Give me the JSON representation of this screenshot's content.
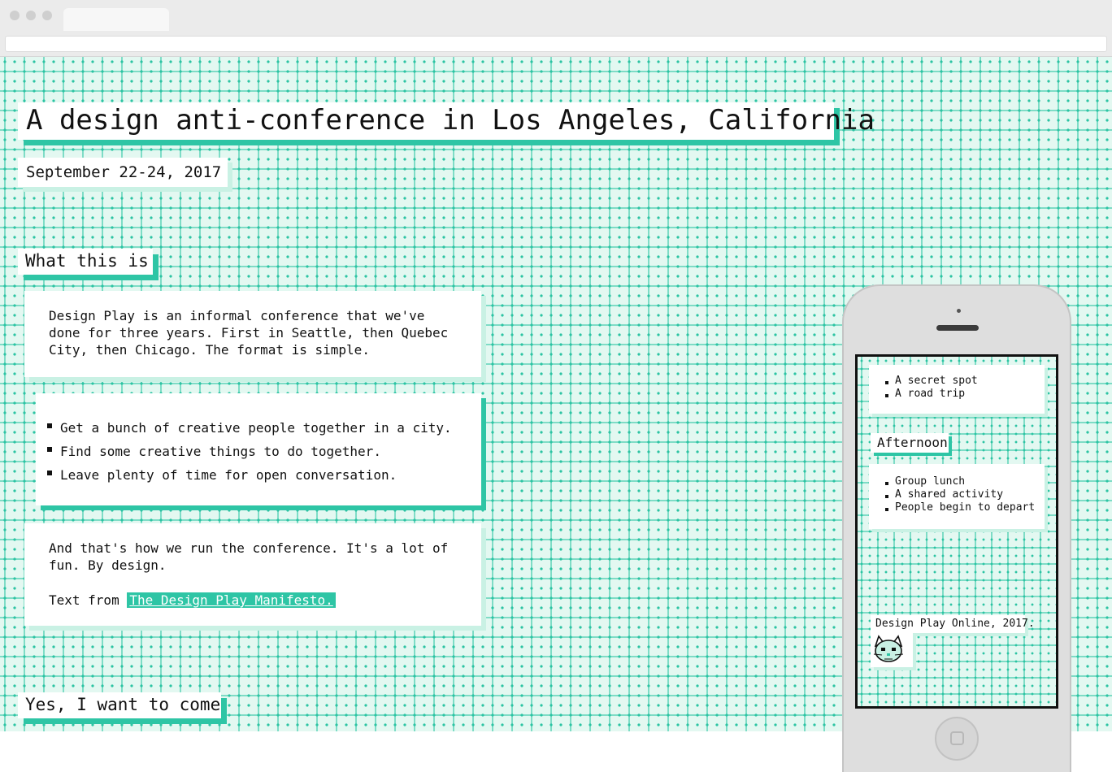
{
  "hero": {
    "title": "A design anti-conference in Los Angeles, California",
    "dates": "September 22-24, 2017"
  },
  "about": {
    "heading": "What this is",
    "intro": "Design Play is an informal conference that we've done for three years. First in Seattle, then Quebec City, then Chicago. The format is simple.",
    "steps": [
      "Get a bunch of creative people together in a city.",
      "Find some creative things to do together.",
      "Leave plenty of time for open conversation."
    ],
    "closing": "And that's how we run the conference. It's a lot of fun. By design.",
    "source_prefix": "Text from",
    "source_link": "The Design Play Manifesto."
  },
  "cta": {
    "label": "Yes, I want to come"
  },
  "phone": {
    "morning_items": [
      "A secret spot",
      "A road trip"
    ],
    "afternoon_heading": "Afternoon",
    "afternoon_items": [
      "Group lunch",
      "A shared activity",
      "People begin to depart"
    ],
    "footer": "Design Play Online, 2017."
  },
  "colors": {
    "accent": "#2ec5a5",
    "accent_light": "#c9f1e4",
    "pattern_bg": "#e3f8f1"
  }
}
